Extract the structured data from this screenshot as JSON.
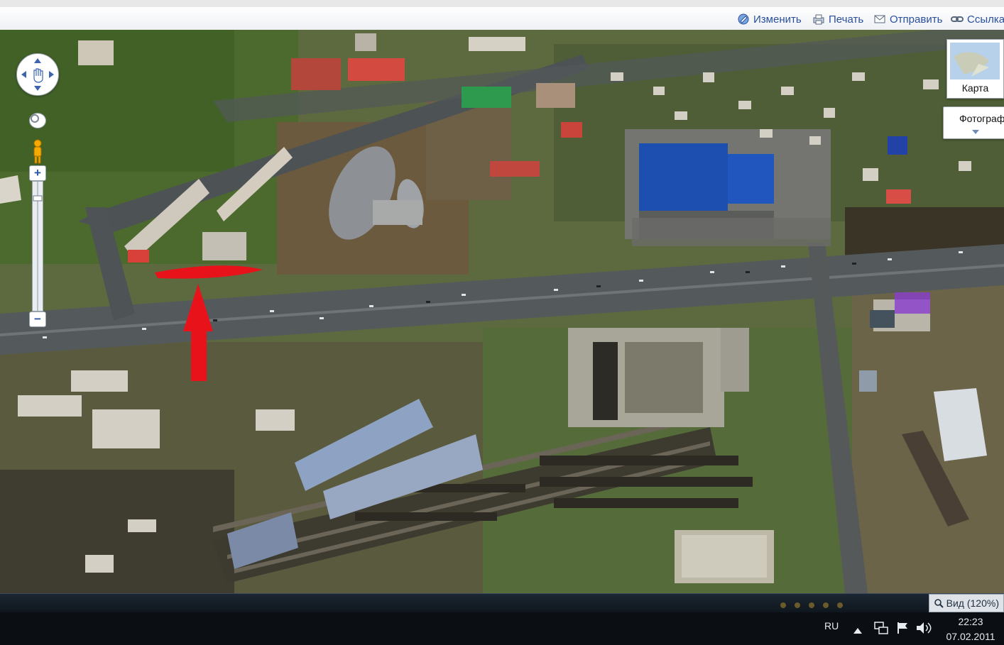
{
  "toolbar": {
    "edit_label": "Изменить",
    "print_label": "Печать",
    "send_label": "Отправить",
    "link_label": "Ссылка"
  },
  "map_type": {
    "map_label": "Карта",
    "photo_label": "Фотограф"
  },
  "map_controls": {
    "zoom_in": "+",
    "zoom_out": "−"
  },
  "taskbar": {
    "zoom_badge": "Вид (120%)",
    "lang": "RU",
    "time": "22:23",
    "date": "07.02.2011"
  },
  "colors": {
    "link_blue": "#2a4f9c",
    "annotation_red": "#e8121b",
    "roof_blue": "#1c4fb0",
    "roof_green": "#2e9a4e",
    "roof_red": "#c23a32"
  },
  "icons": [
    "edit-icon",
    "print-icon",
    "send-icon",
    "link-icon",
    "pan-control-icon",
    "pegman-icon",
    "zoom-slider-icon",
    "volume-icon",
    "flag-icon",
    "network-icon",
    "tray-arrow-icon",
    "magnifier-icon"
  ]
}
